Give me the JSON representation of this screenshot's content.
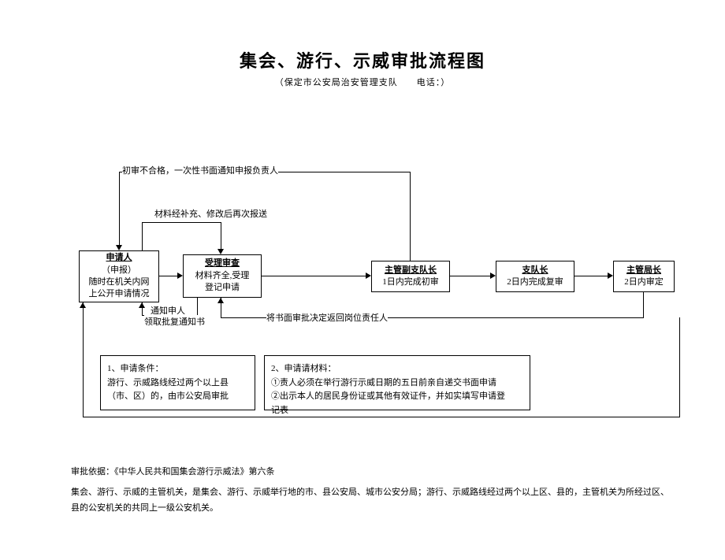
{
  "title": "集会、游行、示威审批流程图",
  "subtitle": "（保定市公安局治安管理支队　　电话：）",
  "labels": {
    "top_reject": "初审不合格，一次性书面通知申报负责人",
    "resubmit": "材料经补充、修改后再次报送",
    "notify_applicant_l1": "通知申人",
    "notify_applicant_l2": "领取批复通知书",
    "return_decision": "将书面审批决定返回岗位责任人"
  },
  "boxes": {
    "applicant": {
      "header": "申请人",
      "paren": "（申报）",
      "l1": "随时在机关内网",
      "l2": "上公开申请情况"
    },
    "review": {
      "header": "受理审查",
      "l1": "材料齐全,受理",
      "l2": "登记申请"
    },
    "vice": {
      "header": "主管副支队长",
      "l1": "1日内完成初审"
    },
    "chief": {
      "header": "支队长",
      "l1": "2日内完成复审"
    },
    "director": {
      "header": "主管局长",
      "l1": "2日内审定"
    }
  },
  "info_left": {
    "l1": "1、申请条件：",
    "l2": "游行、示威路线经过两个以上县",
    "l3": "（市、区）的，由市公安局审批"
  },
  "info_right": {
    "l1": "2、申请请材料：",
    "l2": "①责人必须在举行游行示威日期的五日前亲自递交书面申请",
    "l3": "②出示本人的居民身份证或其他有效证件，并如实填写申请登",
    "l4": "记表"
  },
  "footer": {
    "basis": "审批依据：《中华人民共和国集会游行示威法》第六条",
    "para": "集会、游行、示威的主管机关，是集会、游行、示威举行地的市、县公安局、城市公安分局；游行、示威路线经过两个以上区、县的，主管机关为所经过区、县的公安机关的共同上一级公安机关。"
  }
}
